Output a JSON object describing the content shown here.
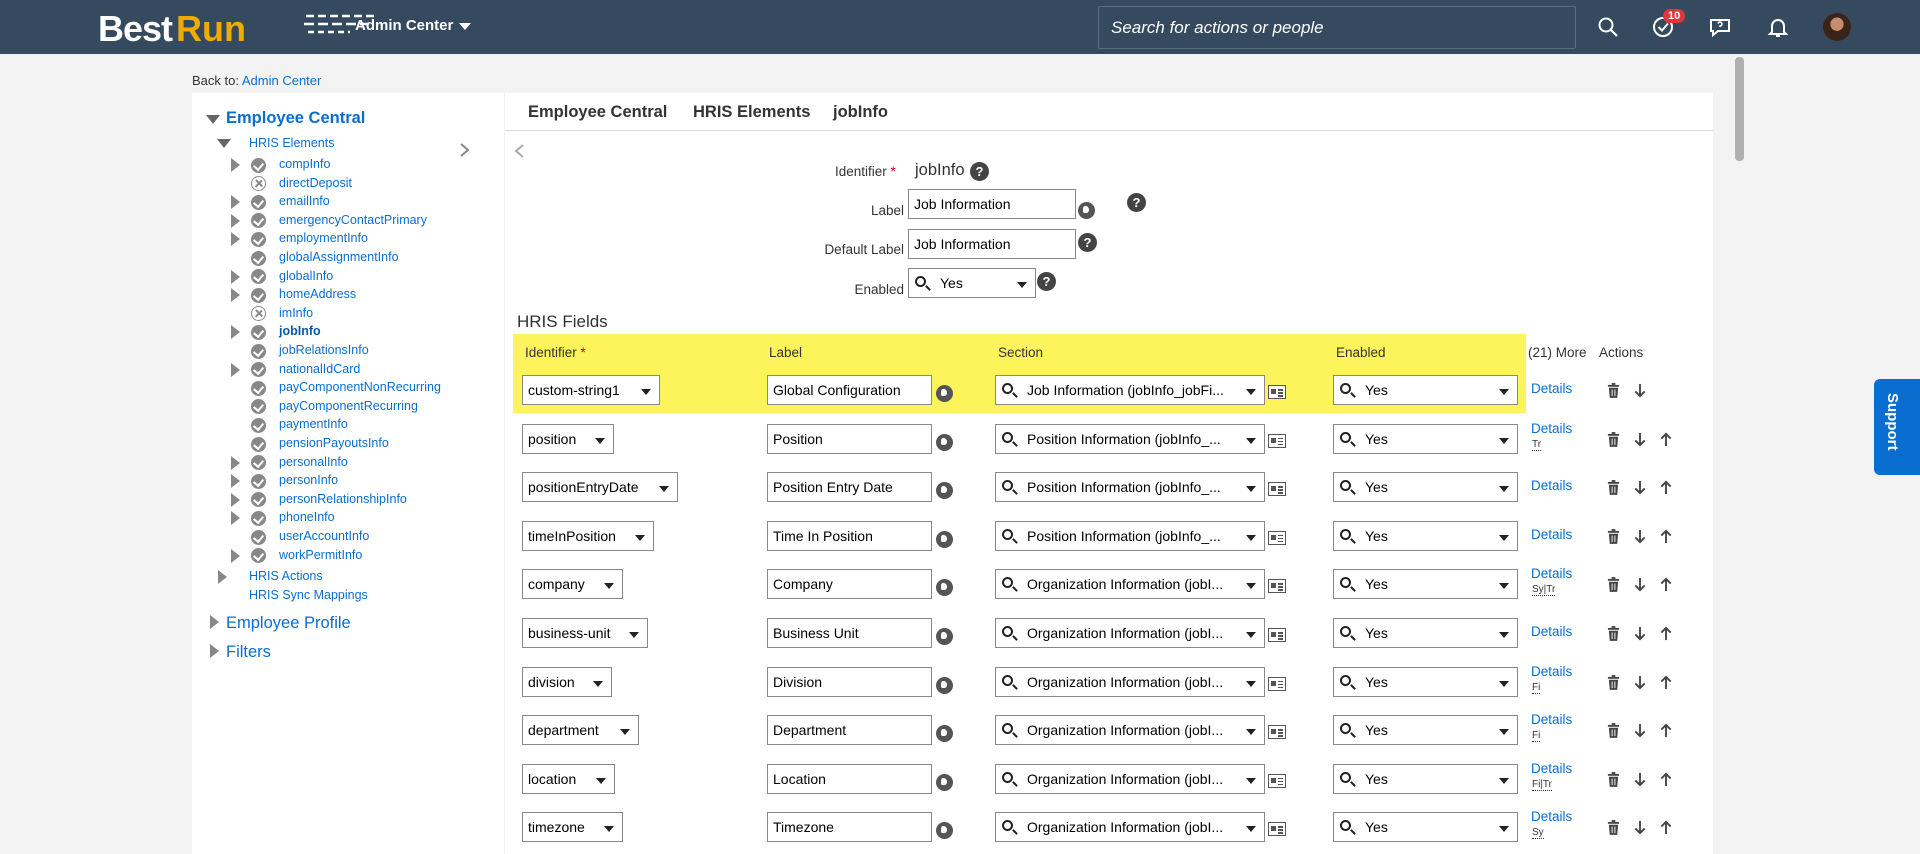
{
  "topbar": {
    "logo_best": "Best",
    "logo_run": "Run",
    "module": "Admin Center",
    "search_placeholder": "Search for actions or people",
    "notification_count": "10"
  },
  "back": {
    "prefix": "Back to: ",
    "link": "Admin Center"
  },
  "sidebar": {
    "root": "Employee Central",
    "group": "HRIS Elements",
    "items": [
      {
        "label": "compInfo",
        "expand": true,
        "status": "check"
      },
      {
        "label": "directDeposit",
        "expand": false,
        "status": "x"
      },
      {
        "label": "emailInfo",
        "expand": true,
        "status": "check"
      },
      {
        "label": "emergencyContactPrimary",
        "expand": true,
        "status": "check"
      },
      {
        "label": "employmentInfo",
        "expand": true,
        "status": "check"
      },
      {
        "label": "globalAssignmentInfo",
        "expand": false,
        "status": "check"
      },
      {
        "label": "globalInfo",
        "expand": true,
        "status": "check"
      },
      {
        "label": "homeAddress",
        "expand": true,
        "status": "check"
      },
      {
        "label": "imInfo",
        "expand": false,
        "status": "x"
      },
      {
        "label": "jobInfo",
        "expand": true,
        "status": "check",
        "selected": true
      },
      {
        "label": "jobRelationsInfo",
        "expand": false,
        "status": "check"
      },
      {
        "label": "nationalIdCard",
        "expand": true,
        "status": "check"
      },
      {
        "label": "payComponentNonRecurring",
        "expand": false,
        "status": "check"
      },
      {
        "label": "payComponentRecurring",
        "expand": false,
        "status": "check"
      },
      {
        "label": "paymentInfo",
        "expand": false,
        "status": "check"
      },
      {
        "label": "pensionPayoutsInfo",
        "expand": false,
        "status": "check"
      },
      {
        "label": "personalInfo",
        "expand": true,
        "status": "check"
      },
      {
        "label": "personInfo",
        "expand": true,
        "status": "check"
      },
      {
        "label": "personRelationshipInfo",
        "expand": true,
        "status": "check"
      },
      {
        "label": "phoneInfo",
        "expand": true,
        "status": "check"
      },
      {
        "label": "userAccountInfo",
        "expand": false,
        "status": "check"
      },
      {
        "label": "workPermitInfo",
        "expand": true,
        "status": "check"
      }
    ],
    "hris_actions": "HRIS Actions",
    "hris_sync": "HRIS Sync Mappings",
    "employee_profile": "Employee Profile",
    "filters": "Filters"
  },
  "breadcrumb": [
    "Employee Central",
    "HRIS Elements",
    "jobInfo"
  ],
  "form": {
    "identifier_label": "Identifier",
    "identifier_required": "*",
    "identifier_value": "jobInfo",
    "label_label": "Label",
    "label_value": "Job Information",
    "default_label_label": "Default Label",
    "default_label_value": "Job Information",
    "enabled_label": "Enabled",
    "enabled_value": "Yes"
  },
  "hris_fields": {
    "title": "HRIS Fields",
    "columns": {
      "identifier": "Identifier",
      "required": "*",
      "label": "Label",
      "section": "Section",
      "enabled": "Enabled",
      "more": "(21) More",
      "actions": "Actions"
    },
    "rows": [
      {
        "identifier": "custom-string1",
        "label": "Global Configuration",
        "section": "Job Information (jobInfo_jobFi...",
        "enabled": "Yes",
        "details": "Details",
        "sub": "",
        "up": false,
        "highlighted": true
      },
      {
        "identifier": "position",
        "label": "Position",
        "section": "Position Information (jobInfo_...",
        "enabled": "Yes",
        "details": "Details",
        "sub": "Tr",
        "up": true
      },
      {
        "identifier": "positionEntryDate",
        "label": "Position Entry Date",
        "section": "Position Information (jobInfo_...",
        "enabled": "Yes",
        "details": "Details",
        "sub": "",
        "up": true
      },
      {
        "identifier": "timeInPosition",
        "label": "Time In Position",
        "section": "Position Information (jobInfo_...",
        "enabled": "Yes",
        "details": "Details",
        "sub": "",
        "up": true
      },
      {
        "identifier": "company",
        "label": "Company",
        "section": "Organization Information (jobI...",
        "enabled": "Yes",
        "details": "Details",
        "sub": "Sy|Tr",
        "up": true
      },
      {
        "identifier": "business-unit",
        "label": "Business Unit",
        "section": "Organization Information (jobI...",
        "enabled": "Yes",
        "details": "Details",
        "sub": "",
        "up": true
      },
      {
        "identifier": "division",
        "label": "Division",
        "section": "Organization Information (jobI...",
        "enabled": "Yes",
        "details": "Details",
        "sub": "Fi",
        "up": true
      },
      {
        "identifier": "department",
        "label": "Department",
        "section": "Organization Information (jobI...",
        "enabled": "Yes",
        "details": "Details",
        "sub": "Fi",
        "up": true
      },
      {
        "identifier": "location",
        "label": "Location",
        "section": "Organization Information (jobI...",
        "enabled": "Yes",
        "details": "Details",
        "sub": "Fi|Tr",
        "up": true
      },
      {
        "identifier": "timezone",
        "label": "Timezone",
        "section": "Organization Information (jobI...",
        "enabled": "Yes",
        "details": "Details",
        "sub": "Sy",
        "up": true
      }
    ]
  },
  "support": "Support",
  "colors": {
    "header": "#354a5f",
    "link": "#0a6ed1",
    "logo_run": "#f0ab00",
    "highlight": "#fcf45a",
    "badge": "#e0363b"
  },
  "icons": [
    "search-icon",
    "approvals-icon",
    "feedback-icon",
    "bell-icon",
    "help-icon",
    "globe-icon",
    "section-icon",
    "trash-icon",
    "arrow-down-icon",
    "arrow-up-icon"
  ]
}
